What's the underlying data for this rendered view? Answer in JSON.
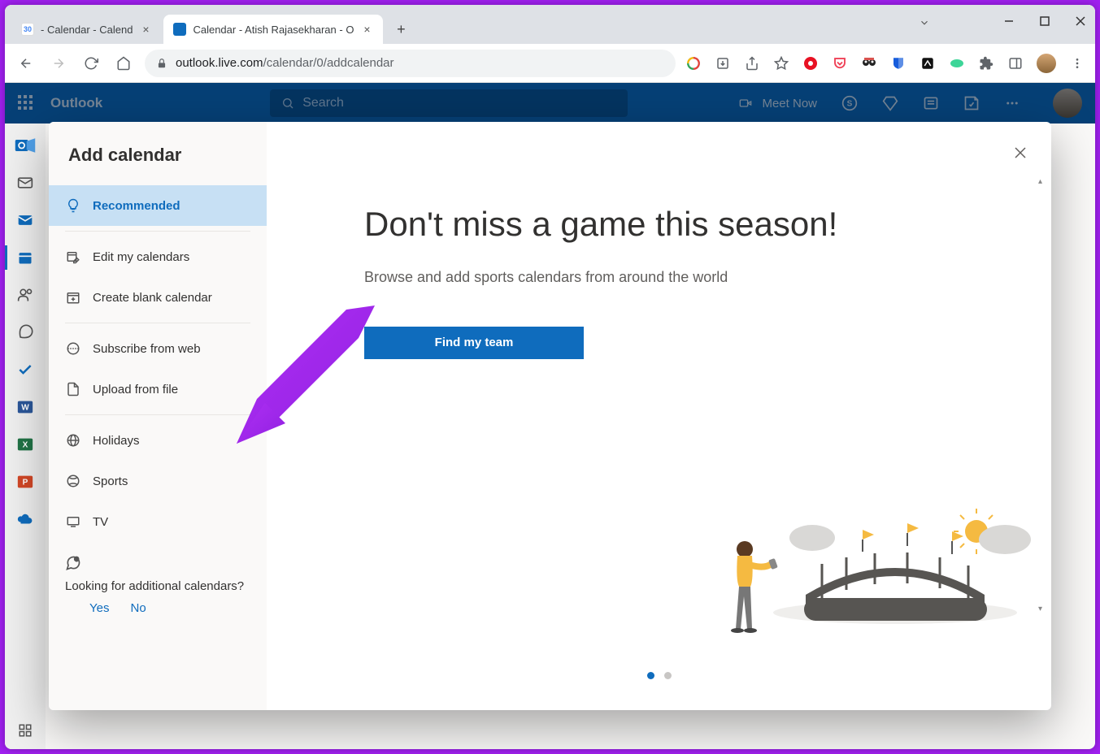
{
  "browser": {
    "tabs": [
      {
        "title": "- Calendar - Calend",
        "icon": "gcal"
      },
      {
        "title": "Calendar - Atish Rajasekharan - O",
        "icon": "ocal"
      }
    ],
    "url_host": "outlook.live.com",
    "url_path": "/calendar/0/addcalendar"
  },
  "outlook": {
    "brand": "Outlook",
    "search_placeholder": "Search",
    "meet_now": "Meet Now"
  },
  "modal": {
    "title": "Add calendar",
    "sidebar": {
      "recommended": "Recommended",
      "edit": "Edit my calendars",
      "create": "Create blank calendar",
      "subscribe": "Subscribe from web",
      "upload": "Upload from file",
      "holidays": "Holidays",
      "sports": "Sports",
      "tv": "TV"
    },
    "feedback": {
      "prompt": "Looking for additional calendars?",
      "yes": "Yes",
      "no": "No"
    },
    "content": {
      "heading": "Don't miss a game this season!",
      "subtitle": "Browse and add sports calendars from around the world",
      "button": "Find my team"
    }
  }
}
